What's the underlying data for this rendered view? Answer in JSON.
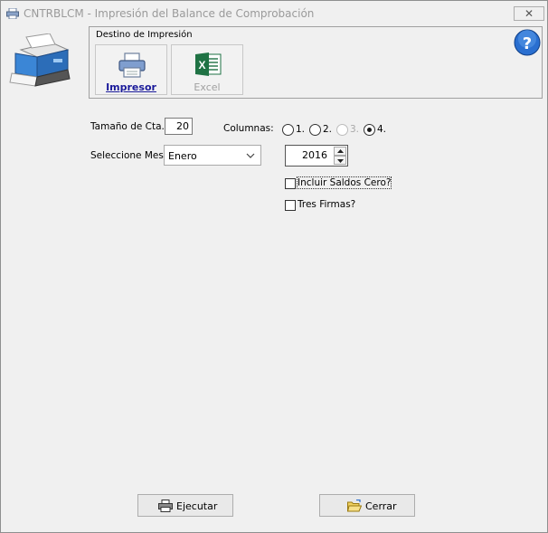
{
  "window": {
    "title": "CNTRBLCM - Impresión del Balance de Comprobación",
    "close_label": "✕"
  },
  "destination": {
    "group_title": "Destino de Impresión",
    "printer_label": "Impresor",
    "excel_label": "Excel",
    "excel_enabled": false
  },
  "form": {
    "account_size_label": "Tamaño de Cta.:",
    "account_size_value": "20",
    "columns_label": "Columnas:",
    "column_options": [
      {
        "label": "1.",
        "selected": false,
        "enabled": true
      },
      {
        "label": "2.",
        "selected": false,
        "enabled": true
      },
      {
        "label": "3.",
        "selected": false,
        "enabled": false
      },
      {
        "label": "4.",
        "selected": true,
        "enabled": true
      }
    ],
    "month_label": "Seleccione Mes",
    "month_value": "Enero",
    "year_value": "2016",
    "include_zero_label": "Incluir Saldos Cero?",
    "include_zero_checked": false,
    "three_signatures_label": "Tres Firmas?",
    "three_signatures_checked": false
  },
  "footer": {
    "execute_label": "Ejecutar",
    "close_label": "Cerrar"
  },
  "colors": {
    "accent": "#1a1a9a",
    "help_blue": "#2a6fd0",
    "excel_green": "#1f7244"
  }
}
